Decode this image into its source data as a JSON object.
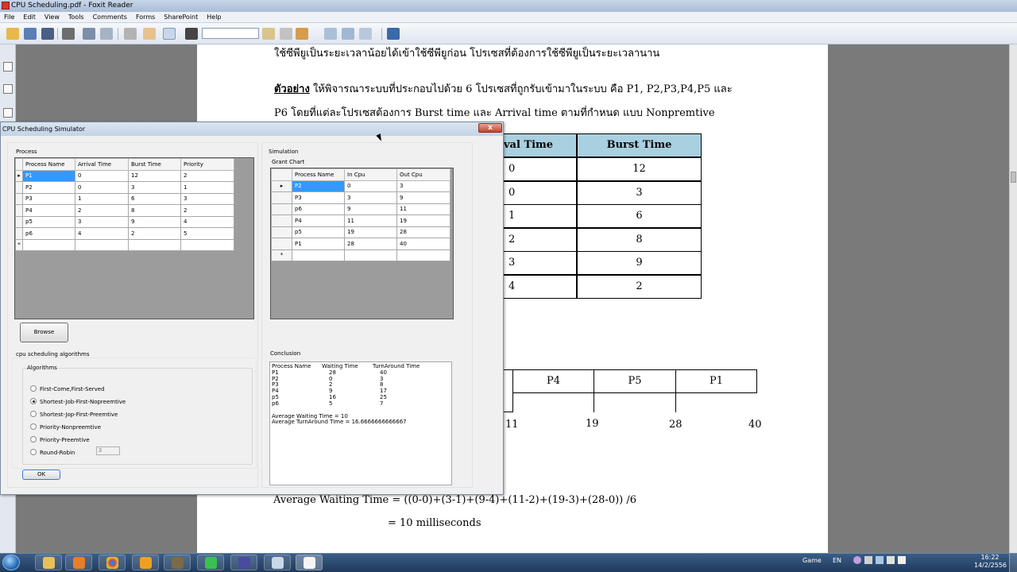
{
  "window": {
    "title": "CPU Scheduling.pdf - Foxit Reader"
  },
  "menu": [
    "File",
    "Edit",
    "View",
    "Tools",
    "Comments",
    "Forms",
    "SharePoint",
    "Help"
  ],
  "pdf": {
    "line1": "ใช้ซีพียูเป็นระยะเวลาน้อยได้เข้าใช้ซีพียูก่อน โปรเซสที่ต้องการใช้ซีพียูเป็นระยะเวลานาน",
    "example_label": "ตัวอย่าง",
    "line2": " ให้พิจารณาระบบที่ประกอบไปด้วย 6 โปรเซสที่ถูกรับเข้ามาในระบบ  คือ P1, P2,P3,P4,P5 และ",
    "line3": "P6  โดยที่แต่ละโปรเซสต้องการ  Burst time และ Arrival time  ตามที่กำหนด  แบบ Nonpremtive",
    "table_headers": [
      "val Time",
      "Burst Time"
    ],
    "table_rows": [
      [
        "0",
        "12"
      ],
      [
        "0",
        "3"
      ],
      [
        "1",
        "6"
      ],
      [
        "2",
        "8"
      ],
      [
        "3",
        "9"
      ],
      [
        "4",
        "2"
      ]
    ],
    "gantt_labels": [
      "P4",
      "P5",
      "P1"
    ],
    "gantt_times": [
      "11",
      "19",
      "28",
      "40"
    ],
    "avg_line1": "Average Waiting Time    =  ((0-0)+(3-1)+(9-4)+(11-2)+(19-3)+(28-0)) /6",
    "avg_line2": "= 10  milliseconds"
  },
  "dialog": {
    "title": "CPU Scheduling Simulator",
    "close": "x",
    "process_group": "Process",
    "process_headers": [
      "Process Name",
      "Arrival Time",
      "Burst Time",
      "Priority"
    ],
    "process_rows": [
      [
        "P1",
        "0",
        "12",
        "2"
      ],
      [
        "P2",
        "0",
        "3",
        "1"
      ],
      [
        "P3",
        "1",
        "6",
        "3"
      ],
      [
        "P4",
        "2",
        "8",
        "2"
      ],
      [
        "p5",
        "3",
        "9",
        "4"
      ],
      [
        "p6",
        "4",
        "2",
        "5"
      ]
    ],
    "browse": "Browse",
    "alg_group": "cpu scheduling algorithms",
    "alg_sub": "Algorithms",
    "algorithms": [
      "First-Come,First-Served",
      "Shortest-Job-First-Nopreemtive",
      "Shortest-Jop-First-Preemtive",
      "Priority-Nonpreemtive",
      "Priority-Preemtive",
      "Round-Robin"
    ],
    "selected_algorithm": 1,
    "quantum": "3",
    "ok": "OK",
    "sim_group": "Simulation",
    "gantt_group": "Grant Chart",
    "gantt_headers": [
      "Process Name",
      "In Cpu",
      "Out Cpu"
    ],
    "gantt_rows": [
      [
        "P2",
        "0",
        "3"
      ],
      [
        "P3",
        "3",
        "9"
      ],
      [
        "p6",
        "9",
        "11"
      ],
      [
        "P4",
        "11",
        "19"
      ],
      [
        "p5",
        "19",
        "28"
      ],
      [
        "P1",
        "28",
        "40"
      ]
    ],
    "conclusion_group": "Conclusion",
    "conclusion_headers": [
      "Process Name",
      "Waiting Time",
      "TurnAround Time"
    ],
    "conclusion_rows": [
      [
        "P1",
        "28",
        "40"
      ],
      [
        "P2",
        "0",
        "3"
      ],
      [
        "P3",
        "2",
        "8"
      ],
      [
        "P4",
        "9",
        "17"
      ],
      [
        "p5",
        "16",
        "25"
      ],
      [
        "p6",
        "5",
        "7"
      ]
    ],
    "avg_waiting": "Average Waiting Time = 10",
    "avg_turnaround": "Average TurnAround Time = 16.6666666666667"
  },
  "taskbar": {
    "game": "Game",
    "lang": "EN",
    "time": "16:22",
    "date": "14/2/2556"
  }
}
